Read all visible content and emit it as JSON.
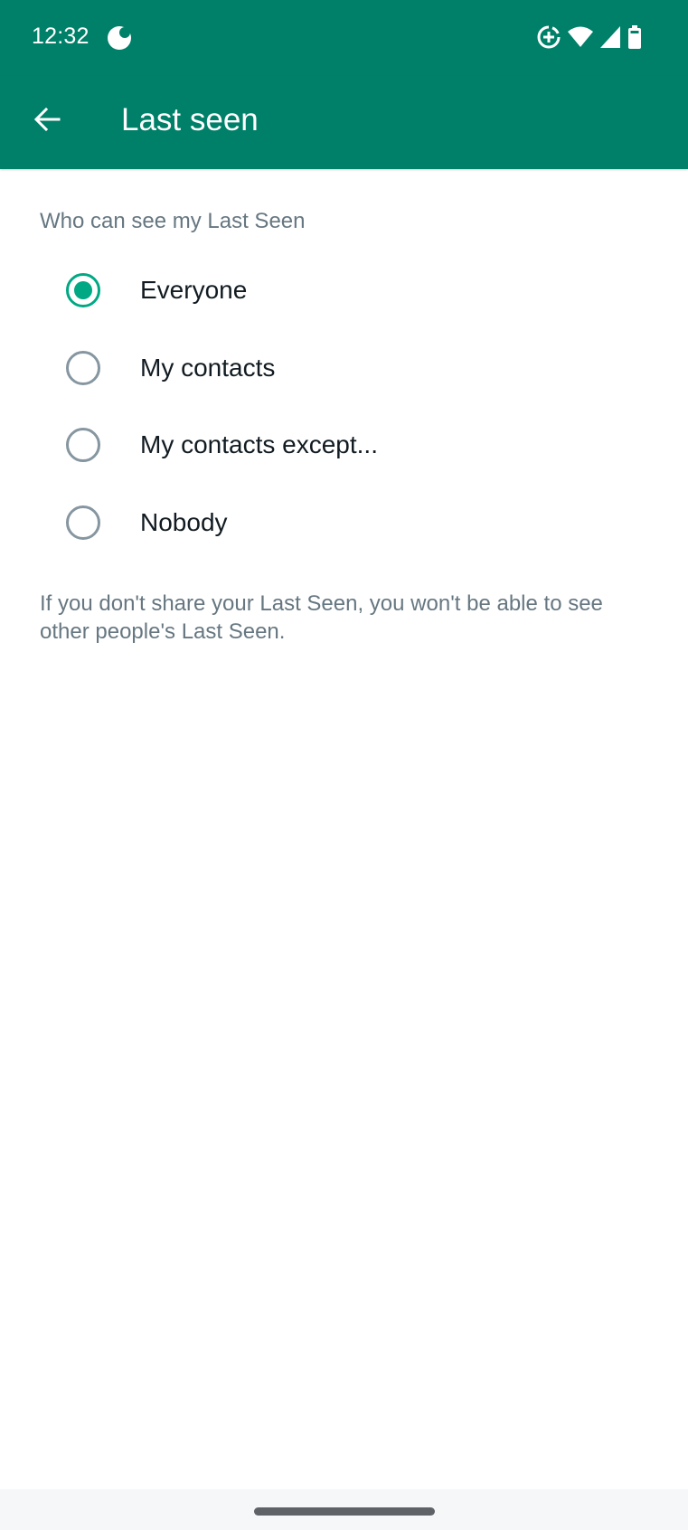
{
  "status_bar": {
    "time": "12:32",
    "icons": [
      "moon-icon",
      "data-saver-icon",
      "wifi-icon",
      "signal-icon",
      "battery-icon"
    ]
  },
  "app_bar": {
    "back_icon": "arrow-left-icon",
    "title": "Last seen"
  },
  "section": {
    "header": "Who can see my Last Seen",
    "options": [
      {
        "label": "Everyone",
        "selected": true
      },
      {
        "label": "My contacts",
        "selected": false
      },
      {
        "label": "My contacts except...",
        "selected": false
      },
      {
        "label": "Nobody",
        "selected": false
      }
    ],
    "footnote": "If you don't share your Last Seen, you won't be able to see other people's Last Seen."
  },
  "colors": {
    "brand": "#008069",
    "accent": "#00a884",
    "radio_unselected": "#8696a0",
    "secondary_text": "#667781",
    "primary_text": "#111b21"
  }
}
